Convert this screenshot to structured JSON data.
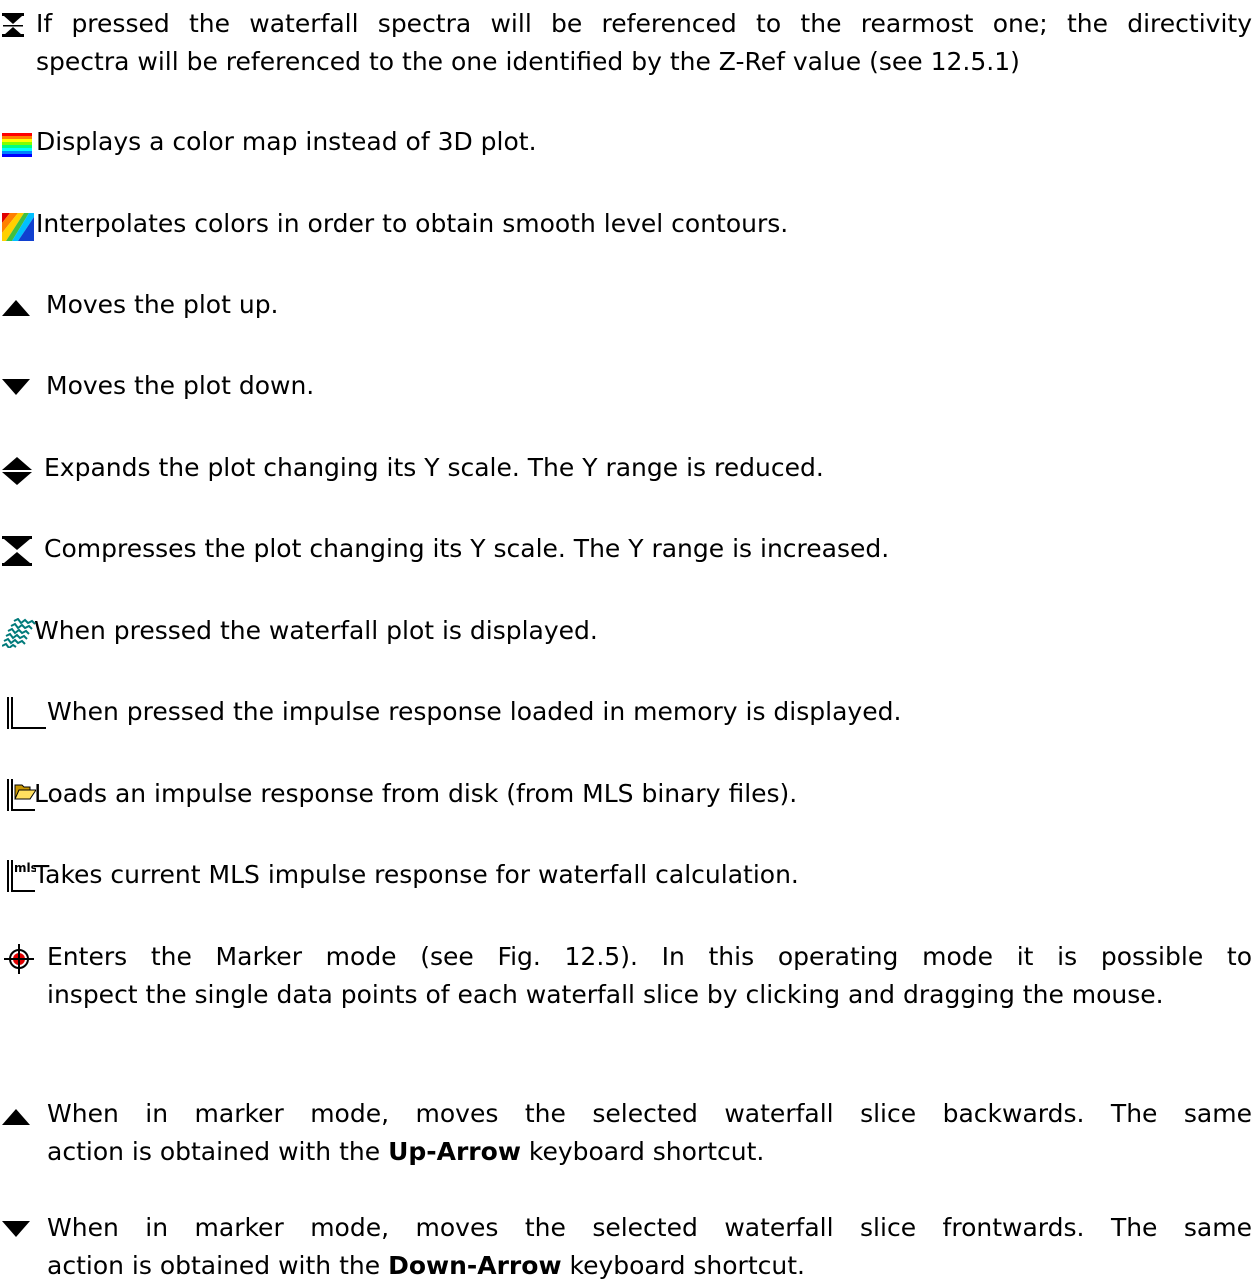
{
  "items": [
    {
      "id": "reference",
      "icon": "reference-icon",
      "l1": "If pressed the waterfall spectra will be referenced to the rearmost one; the directivity",
      "rest": "spectra will be referenced to the one identified by the Z-Ref value (see 12.5.1)"
    },
    {
      "id": "colormap",
      "icon": "color-map-icon",
      "l1": "Displays a color map instead of 3D plot."
    },
    {
      "id": "interpolate",
      "icon": "interpolate-colors-icon",
      "l1": "Interpolates colors in order to obtain smooth level contours."
    },
    {
      "id": "plot-up",
      "icon": "arrow-up-icon",
      "l1": "Moves the plot up."
    },
    {
      "id": "plot-down",
      "icon": "arrow-down-icon",
      "l1": "Moves the plot down."
    },
    {
      "id": "expand",
      "icon": "expand-icon",
      "l1": "Expands the plot changing its Y scale. The Y range is reduced."
    },
    {
      "id": "compress",
      "icon": "compress-icon",
      "l1": "Compresses the plot changing its Y scale. The Y range is increased."
    },
    {
      "id": "waterfall",
      "icon": "waterfall-icon",
      "l1": "When pressed the waterfall plot is displayed."
    },
    {
      "id": "impulse",
      "icon": "impulse-response-icon",
      "l1": "When pressed the impulse response loaded in memory is displayed."
    },
    {
      "id": "load",
      "icon": "load-impulse-icon",
      "l1": "Loads an impulse response from disk (from MLS binary files)."
    },
    {
      "id": "mls",
      "icon": "mls-impulse-icon",
      "l1": "Takes current MLS impulse response for waterfall calculation."
    },
    {
      "id": "marker",
      "icon": "marker-icon",
      "l1": "Enters the Marker mode (see Fig. 12.5). In this operating mode it is possible to",
      "rest": "inspect the single data points of each waterfall slice by clicking and dragging the mouse."
    },
    {
      "id": "slice-back",
      "icon": "arrow-up-icon",
      "l1": "When in marker mode, moves the selected waterfall slice backwards. The same",
      "rest_a": "action is obtained with the ",
      "rest_b": "Up-Arrow",
      "rest_c": " keyboard shortcut."
    },
    {
      "id": "slice-front",
      "icon": "arrow-down-icon",
      "l1": "When in marker mode, moves the selected waterfall slice frontwards. The same",
      "rest_a": "action is obtained with the ",
      "rest_b": "Down-Arrow",
      "rest_c": " keyboard shortcut."
    }
  ]
}
